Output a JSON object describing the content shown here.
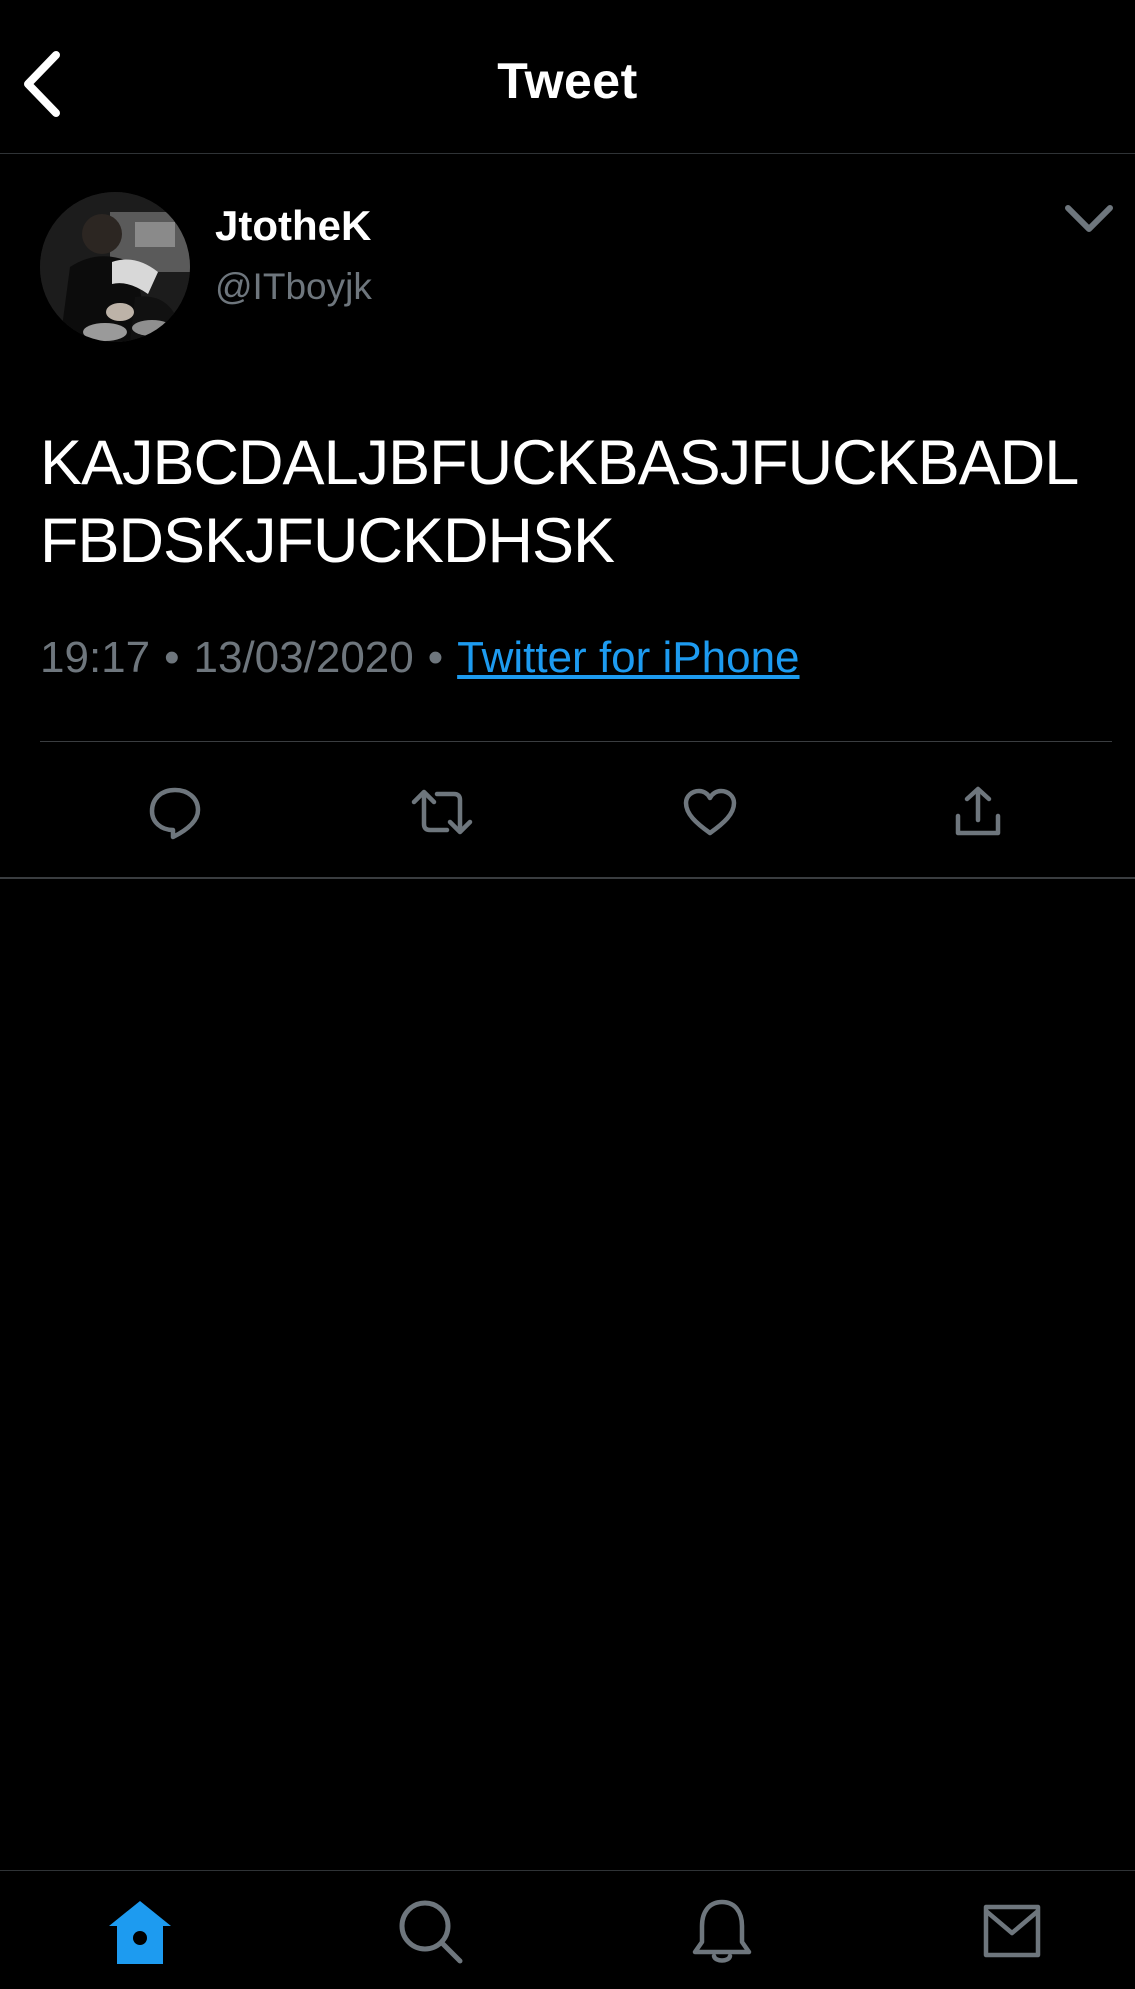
{
  "header": {
    "title": "Tweet",
    "back_icon": "chevron-left-icon"
  },
  "tweet": {
    "author": {
      "name": "JtotheK",
      "handle": "@ITboyjk"
    },
    "text": "KAJBCDALJBFUCKBASJFUCKBADLFBDSKJFUCKDHSK",
    "time": "19:17",
    "date": "13/03/2020",
    "separator": "•",
    "source": "Twitter for iPhone",
    "actions": [
      "reply-icon",
      "retweet-icon",
      "like-icon",
      "share-icon"
    ]
  },
  "tabbar": {
    "items": [
      "home-icon",
      "search-icon",
      "notifications-icon",
      "messages-icon"
    ],
    "active": "home-icon"
  },
  "colors": {
    "background": "#000000",
    "text": "#ffffff",
    "secondary_text": "#6e767d",
    "accent": "#1d9bf0",
    "divider": "#3a3d40"
  }
}
